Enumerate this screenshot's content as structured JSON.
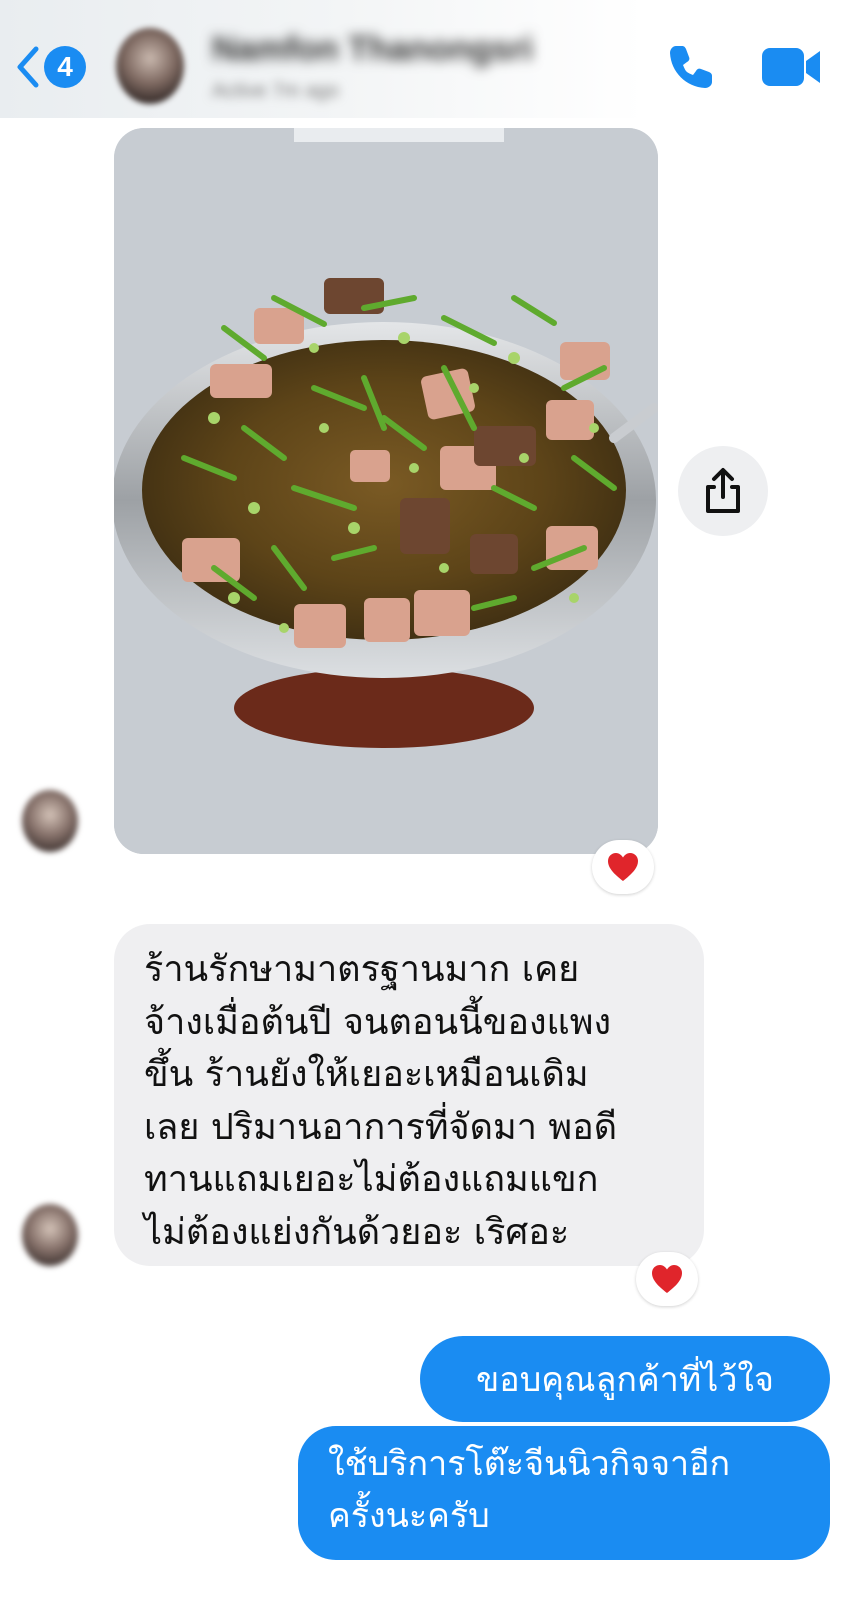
{
  "header": {
    "unread_count": "4",
    "contact_name": "Namfon Thanongsri",
    "contact_status": "Active 7m ago"
  },
  "colors": {
    "accent": "#1a8cf2",
    "incoming_bubble": "#efeff1",
    "reaction_heart": "#e0252b"
  },
  "messages": {
    "photo_reaction": "❤️",
    "incoming_text_lines": [
      "ร้านรักษามาตรฐานมาก เคย",
      "จ้างเมื่อต้นปี จนตอนนี้ของแพง",
      "ขึ้น ร้านยังให้เยอะเหมือนเดิม",
      "เลย ปริมานอาการที่จัดมา พอดี",
      "ทานแถมเยอะไม่ต้องแถมแขก",
      "ไม่ต้องแย่งกันด้วยอะ เริศอะ"
    ],
    "text_reaction": "❤️",
    "outgoing_1": "ขอบคุณลูกค้าที่ไว้ใจ",
    "outgoing_2_lines": [
      "ใช้บริการโต๊ะจีนนิวกิจจาอีก",
      "ครั้งนะครับ"
    ]
  }
}
